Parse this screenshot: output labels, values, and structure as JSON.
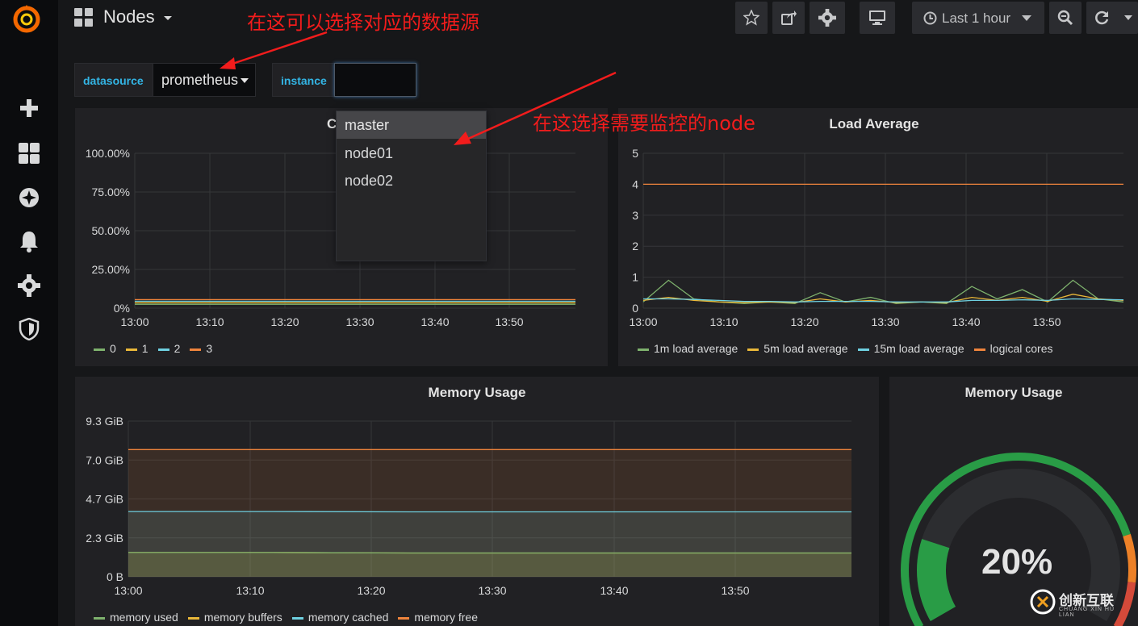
{
  "header": {
    "dashboard_title": "Nodes",
    "time_range_label": "Last 1 hour"
  },
  "annotations": {
    "datasource_hint": "在这可以选择对应的数据源",
    "instance_hint": "在这选择需要监控的node"
  },
  "variables": {
    "datasource": {
      "label": "datasource",
      "value": "prometheus"
    },
    "instance": {
      "label": "instance",
      "value": ""
    }
  },
  "instance_dropdown": {
    "options": [
      "master",
      "node01",
      "node02"
    ],
    "highlighted": "master"
  },
  "panels": {
    "cpu": {
      "title": "CPU"
    },
    "load": {
      "title": "Load Average"
    },
    "memory": {
      "title": "Memory Usage"
    },
    "memory_gauge": {
      "title": "Memory Usage",
      "value": "20%",
      "fraction": 0.2
    }
  },
  "colors": {
    "green": "#7eb26d",
    "yellow": "#eab839",
    "cyan": "#6ed0e0",
    "orange": "#ef843c",
    "gauge_green": "#299c46",
    "gauge_orange": "#ed8128",
    "gauge_red": "#d44a3a"
  },
  "watermark": {
    "text": "创新互联",
    "sub": "CHUANG XIN HU LIAN"
  },
  "chart_data": [
    {
      "type": "line",
      "title": "CPU",
      "x": [
        "13:00",
        "13:10",
        "13:20",
        "13:30",
        "13:40",
        "13:50"
      ],
      "y_ticks": [
        "0%",
        "25.00%",
        "50.00%",
        "75.00%",
        "100.00%"
      ],
      "ylim": [
        0,
        100
      ],
      "series": [
        {
          "name": "0",
          "values": [
            2.5,
            2.5,
            2.5,
            2.5,
            2.5,
            2.5
          ]
        },
        {
          "name": "1",
          "values": [
            3.5,
            3.5,
            3.5,
            3.5,
            3.5,
            3.5
          ]
        },
        {
          "name": "2",
          "values": [
            4.5,
            4.5,
            4.5,
            4.5,
            4.5,
            4.5
          ]
        },
        {
          "name": "3",
          "values": [
            5.5,
            5.5,
            5.5,
            5.5,
            5.5,
            5.5
          ]
        }
      ],
      "legend": "bottom-left"
    },
    {
      "type": "line",
      "title": "Load Average",
      "x": [
        "13:00",
        "13:10",
        "13:20",
        "13:30",
        "13:40",
        "13:50"
      ],
      "y_ticks": [
        "0",
        "1",
        "2",
        "3",
        "4",
        "5"
      ],
      "ylim": [
        0,
        5
      ],
      "series": [
        {
          "name": "1m load average",
          "values": [
            0.2,
            0.9,
            0.3,
            0.2,
            0.15,
            0.2,
            0.15,
            0.5,
            0.2,
            0.35,
            0.15,
            0.2,
            0.15,
            0.7,
            0.3,
            0.6,
            0.2,
            0.9,
            0.3,
            0.2
          ]
        },
        {
          "name": "5m load average",
          "values": [
            0.25,
            0.35,
            0.25,
            0.2,
            0.18,
            0.2,
            0.18,
            0.3,
            0.2,
            0.25,
            0.18,
            0.2,
            0.18,
            0.35,
            0.25,
            0.35,
            0.22,
            0.45,
            0.3,
            0.25
          ]
        },
        {
          "name": "15m load average",
          "values": [
            0.3,
            0.3,
            0.28,
            0.25,
            0.22,
            0.22,
            0.2,
            0.22,
            0.22,
            0.22,
            0.2,
            0.2,
            0.2,
            0.25,
            0.25,
            0.27,
            0.25,
            0.3,
            0.28,
            0.27
          ]
        },
        {
          "name": "logical cores",
          "values": [
            4,
            4,
            4,
            4,
            4,
            4,
            4,
            4,
            4,
            4,
            4,
            4,
            4,
            4,
            4,
            4,
            4,
            4,
            4,
            4
          ]
        }
      ],
      "legend": "bottom-left"
    },
    {
      "type": "area",
      "title": "Memory Usage",
      "x": [
        "13:00",
        "13:10",
        "13:20",
        "13:30",
        "13:40",
        "13:50"
      ],
      "y_ticks": [
        "0 B",
        "2.3 GiB",
        "4.7 GiB",
        "7.0 GiB",
        "9.3 GiB"
      ],
      "ylim": [
        0,
        9.3
      ],
      "series": [
        {
          "name": "memory used",
          "values": [
            1.45,
            1.45,
            1.42,
            1.42,
            1.42,
            1.42
          ]
        },
        {
          "name": "memory buffers",
          "values": [
            1.45,
            1.45,
            1.42,
            1.42,
            1.42,
            1.42
          ]
        },
        {
          "name": "memory cached",
          "values": [
            3.9,
            3.9,
            3.88,
            3.88,
            3.88,
            3.88
          ]
        },
        {
          "name": "memory free",
          "values": [
            7.6,
            7.6,
            7.6,
            7.6,
            7.6,
            7.6
          ]
        }
      ],
      "legend": "bottom-left"
    }
  ]
}
